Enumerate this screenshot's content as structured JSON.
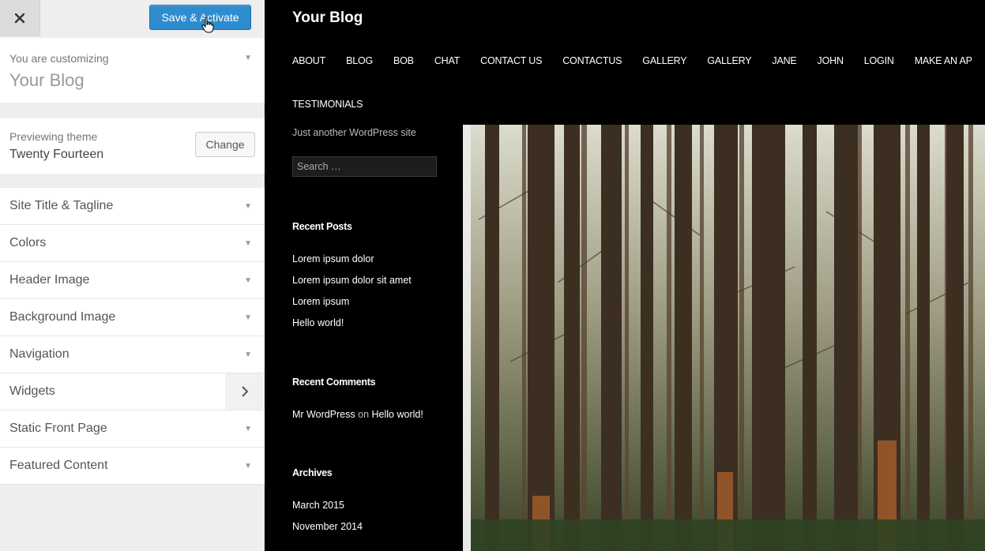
{
  "customizer": {
    "save_label": "Save & Activate",
    "customizing_label": "You are customizing",
    "site_name": "Your Blog",
    "previewing_label": "Previewing theme",
    "theme_name": "Twenty Fourteen",
    "change_label": "Change",
    "sections": [
      {
        "label": "Site Title & Tagline"
      },
      {
        "label": "Colors"
      },
      {
        "label": "Header Image"
      },
      {
        "label": "Background Image"
      },
      {
        "label": "Navigation"
      },
      {
        "label": "Widgets"
      },
      {
        "label": "Static Front Page"
      },
      {
        "label": "Featured Content"
      }
    ]
  },
  "preview": {
    "site_title": "Your Blog",
    "nav": [
      "About",
      "Blog",
      "Bob",
      "Chat",
      "Contact Us",
      "ContactUs",
      "Gallery",
      "Gallery",
      "Jane",
      "John",
      "Login",
      "Make an Ap"
    ],
    "nav_row2": [
      "Testimonials"
    ],
    "tagline": "Just another WordPress site",
    "search_placeholder": "Search …",
    "recent_posts": {
      "title": "Recent Posts",
      "items": [
        "Lorem ipsum dolor",
        "Lorem ipsum dolor sit amet",
        "Lorem ipsum",
        "Hello world!"
      ]
    },
    "recent_comments": {
      "title": "Recent Comments",
      "author": "Mr WordPress",
      "on": "on",
      "post": "Hello world!"
    },
    "archives": {
      "title": "Archives",
      "items": [
        "March 2015",
        "November 2014"
      ]
    }
  },
  "colors": {
    "accent": "#2e8ccf",
    "sidebar_bg": "#eeeeee",
    "preview_bg": "#000000"
  }
}
